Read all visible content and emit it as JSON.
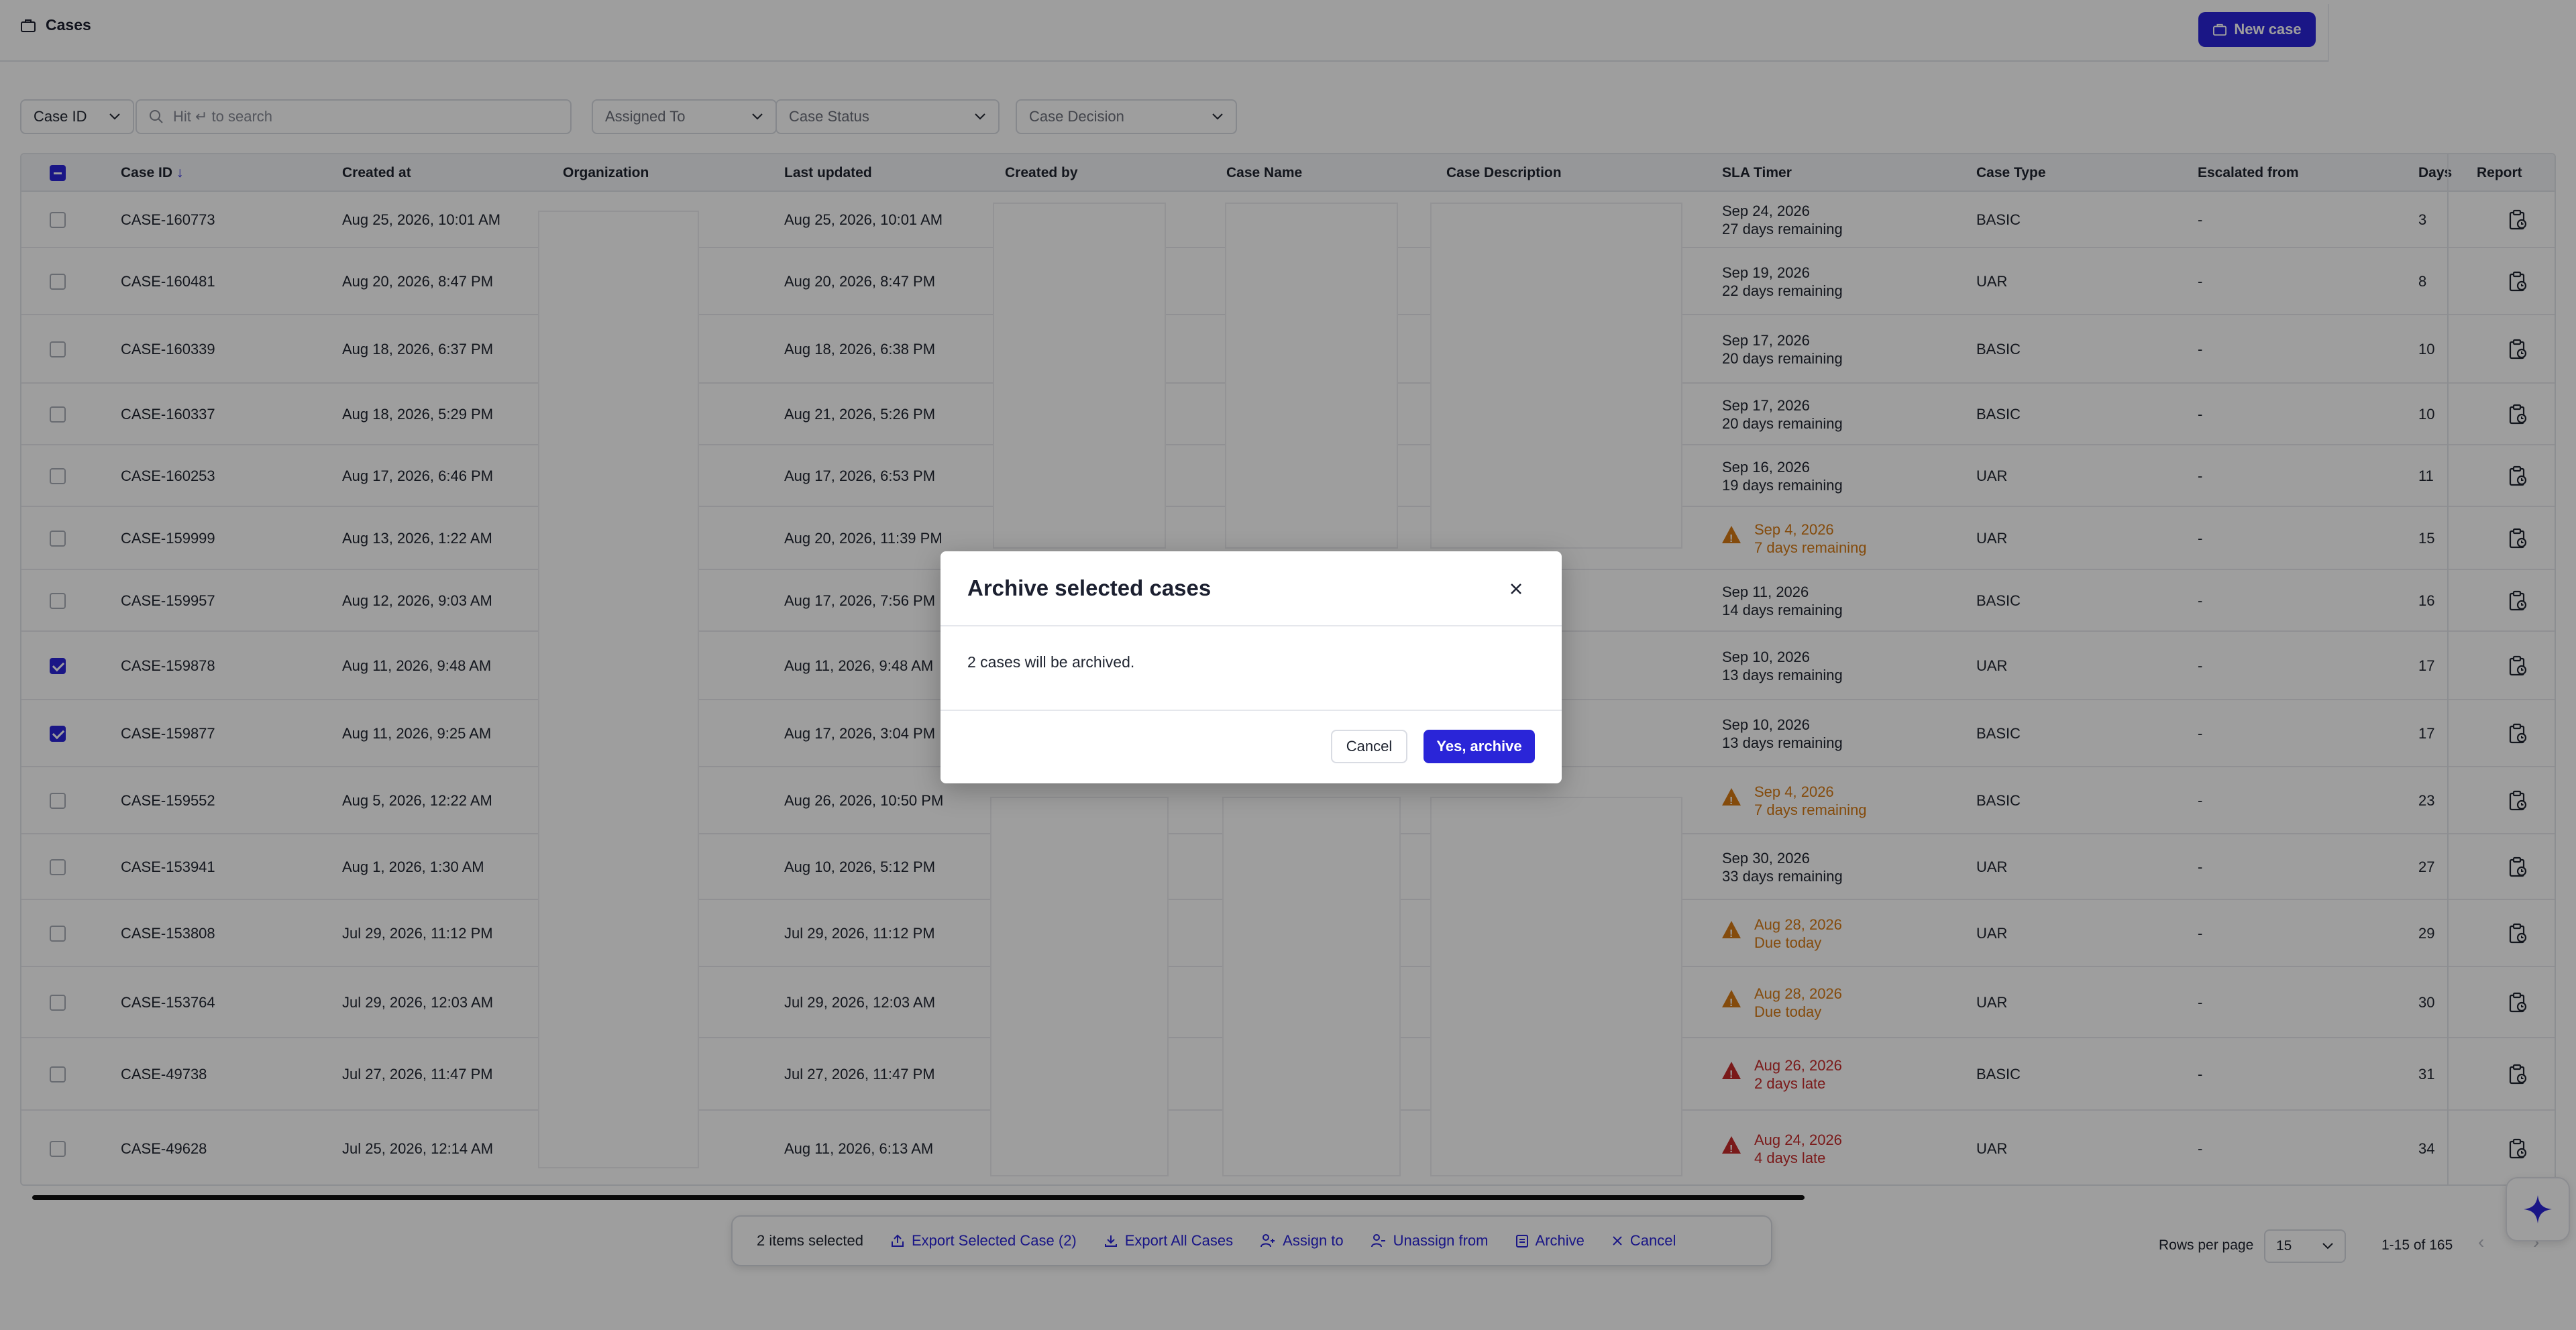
{
  "header": {
    "title": "Cases",
    "new_case_label": "New case"
  },
  "filters": {
    "case_id_select": "Case ID",
    "search_placeholder": "Hit ↵ to search",
    "assigned_to": "Assigned To",
    "case_status": "Case Status",
    "case_decision": "Case Decision"
  },
  "table": {
    "columns": [
      "Case ID",
      "Created at",
      "Organization",
      "Last updated",
      "Created by",
      "Case Name",
      "Case Description",
      "SLA Timer",
      "Case Type",
      "Escalated from",
      "Days",
      "Report"
    ],
    "sort_indicator": "↓",
    "rows": [
      {
        "id": "CASE-160773",
        "created": "Aug 25, 2026, 10:01 AM",
        "updated": "Aug 25, 2026, 10:01 AM",
        "sla_date": "Sep 24, 2026",
        "sla_note": "27 days remaining",
        "sla_state": "ok",
        "type": "BASIC",
        "escalated": "-",
        "days": "3",
        "checked": false
      },
      {
        "id": "CASE-160481",
        "created": "Aug 20, 2026, 8:47 PM",
        "updated": "Aug 20, 2026, 8:47 PM",
        "sla_date": "Sep 19, 2026",
        "sla_note": "22 days remaining",
        "sla_state": "ok",
        "type": "UAR",
        "escalated": "-",
        "days": "8",
        "checked": false
      },
      {
        "id": "CASE-160339",
        "created": "Aug 18, 2026, 6:37 PM",
        "updated": "Aug 18, 2026, 6:38 PM",
        "sla_date": "Sep 17, 2026",
        "sla_note": "20 days remaining",
        "sla_state": "ok",
        "type": "BASIC",
        "escalated": "-",
        "days": "10",
        "checked": false
      },
      {
        "id": "CASE-160337",
        "created": "Aug 18, 2026, 5:29 PM",
        "updated": "Aug 21, 2026, 5:26 PM",
        "sla_date": "Sep 17, 2026",
        "sla_note": "20 days remaining",
        "sla_state": "ok",
        "type": "BASIC",
        "escalated": "-",
        "days": "10",
        "checked": false
      },
      {
        "id": "CASE-160253",
        "created": "Aug 17, 2026, 6:46 PM",
        "updated": "Aug 17, 2026, 6:53 PM",
        "sla_date": "Sep 16, 2026",
        "sla_note": "19 days remaining",
        "sla_state": "ok",
        "type": "UAR",
        "escalated": "-",
        "days": "11",
        "checked": false
      },
      {
        "id": "CASE-159999",
        "created": "Aug 13, 2026, 1:22 AM",
        "updated": "Aug 20, 2026, 11:39 PM",
        "sla_date": "Sep 4, 2026",
        "sla_note": "7 days remaining",
        "sla_state": "warn",
        "type": "UAR",
        "escalated": "-",
        "days": "15",
        "checked": false
      },
      {
        "id": "CASE-159957",
        "created": "Aug 12, 2026, 9:03 AM",
        "updated": "Aug 17, 2026, 7:56 PM",
        "sla_date": "Sep 11, 2026",
        "sla_note": "14 days remaining",
        "sla_state": "ok",
        "type": "BASIC",
        "escalated": "-",
        "days": "16",
        "checked": false
      },
      {
        "id": "CASE-159878",
        "created": "Aug 11, 2026, 9:48 AM",
        "updated": "Aug 11, 2026, 9:48 AM",
        "sla_date": "Sep 10, 2026",
        "sla_note": "13 days remaining",
        "sla_state": "ok",
        "type": "UAR",
        "escalated": "-",
        "days": "17",
        "checked": true
      },
      {
        "id": "CASE-159877",
        "created": "Aug 11, 2026, 9:25 AM",
        "updated": "Aug 17, 2026, 3:04 PM",
        "sla_date": "Sep 10, 2026",
        "sla_note": "13 days remaining",
        "sla_state": "ok",
        "type": "BASIC",
        "escalated": "-",
        "days": "17",
        "checked": true
      },
      {
        "id": "CASE-159552",
        "created": "Aug 5, 2026, 12:22 AM",
        "updated": "Aug 26, 2026, 10:50 PM",
        "sla_date": "Sep 4, 2026",
        "sla_note": "7 days remaining",
        "sla_state": "warn",
        "type": "BASIC",
        "escalated": "-",
        "days": "23",
        "checked": false
      },
      {
        "id": "CASE-153941",
        "created": "Aug 1, 2026, 1:30 AM",
        "updated": "Aug 10, 2026, 5:12 PM",
        "sla_date": "Sep 30, 2026",
        "sla_note": "33 days remaining",
        "sla_state": "ok",
        "type": "UAR",
        "escalated": "-",
        "days": "27",
        "checked": false
      },
      {
        "id": "CASE-153808",
        "created": "Jul 29, 2026, 11:12 PM",
        "updated": "Jul 29, 2026, 11:12 PM",
        "sla_date": "Aug 28, 2026",
        "sla_note": "Due today",
        "sla_state": "warn",
        "type": "UAR",
        "escalated": "-",
        "days": "29",
        "checked": false
      },
      {
        "id": "CASE-153764",
        "created": "Jul 29, 2026, 12:03 AM",
        "updated": "Jul 29, 2026, 12:03 AM",
        "sla_date": "Aug 28, 2026",
        "sla_note": "Due today",
        "sla_state": "warn",
        "type": "UAR",
        "escalated": "-",
        "days": "30",
        "checked": false
      },
      {
        "id": "CASE-49738",
        "created": "Jul 27, 2026, 11:47 PM",
        "updated": "Jul 27, 2026, 11:47 PM",
        "sla_date": "Aug 26, 2026",
        "sla_note": "2 days late",
        "sla_state": "late",
        "type": "BASIC",
        "escalated": "-",
        "days": "31",
        "checked": false
      },
      {
        "id": "CASE-49628",
        "created": "Jul 25, 2026, 12:14 AM",
        "updated": "Aug 11, 2026, 6:13 AM",
        "sla_date": "Aug 24, 2026",
        "sla_note": "4 days late",
        "sla_state": "late",
        "type": "UAR",
        "escalated": "-",
        "days": "34",
        "checked": false
      }
    ]
  },
  "bulk_bar": {
    "selected_text": "2 items selected",
    "export_selected": "Export Selected Case (2)",
    "export_all": "Export All Cases",
    "assign": "Assign to",
    "unassign": "Unassign from",
    "archive": "Archive",
    "cancel": "Cancel"
  },
  "pagination": {
    "rows_per_page_label": "Rows per page",
    "rows_per_page_value": "15",
    "range": "1-15 of 165"
  },
  "modal": {
    "title": "Archive selected cases",
    "body": "2 cases will be archived.",
    "cancel_label": "Cancel",
    "confirm_label": "Yes, archive"
  },
  "colors": {
    "accent": "#2a25d8",
    "warning": "#d67a14",
    "danger": "#c62a2a"
  }
}
